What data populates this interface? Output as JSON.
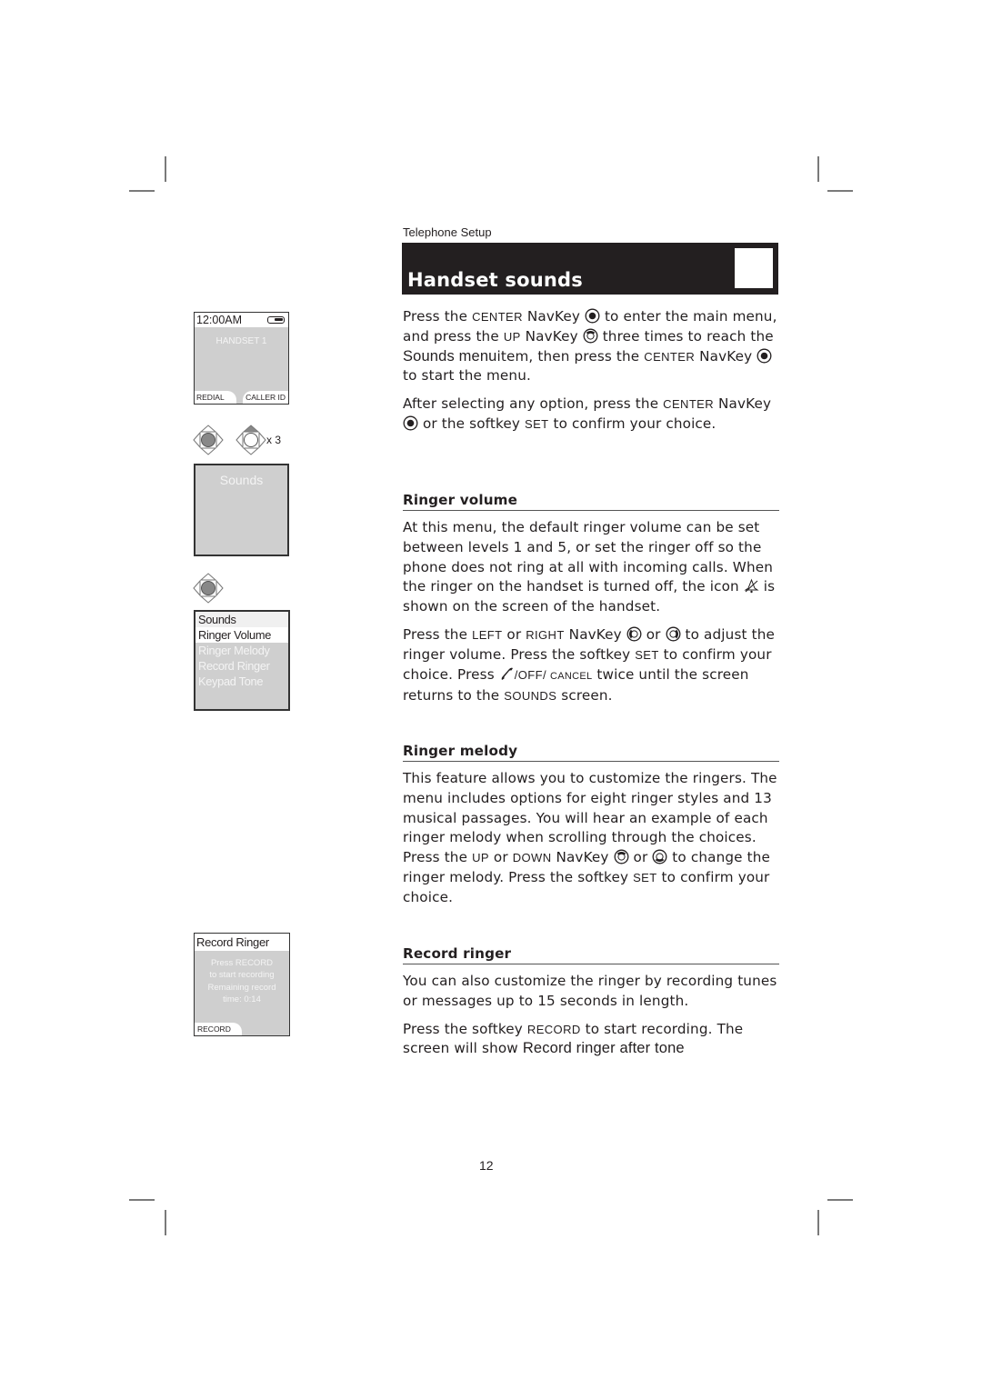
{
  "running_head": "Telephone Setup",
  "title": "Handset sounds",
  "page_number": "12",
  "screens": {
    "idle": {
      "time": "12:00AM",
      "battery_icon": "battery-icon",
      "handset_label": "HANDSET 1",
      "softkey_left": "REDIAL",
      "softkey_right": "CALLER ID"
    },
    "nav_step_1": {
      "icon": "navkey-center-icon"
    },
    "nav_step_2": {
      "icon": "navkey-up-icon",
      "repeat": "x 3"
    },
    "sounds_menu_title": "Sounds",
    "nav_step_3": {
      "icon": "navkey-center-icon"
    },
    "sounds_list": {
      "header": "Sounds",
      "items": [
        "Ringer Volume",
        "Ringer Melody",
        "Record Ringer",
        "Keypad Tone"
      ],
      "selected_index": 0
    },
    "record_ringer": {
      "header": "Record Ringer",
      "lines": [
        "Press RECORD",
        "to start recording",
        "Remaining record",
        "time:   0:14"
      ],
      "softkey": "RECORD"
    }
  },
  "intro": {
    "p1": {
      "t1": "Press the ",
      "k1": "CENTER",
      "t2": " NavKey ",
      "t3": " to enter the main menu, and press the ",
      "k2": "UP",
      "t4": " NavKey ",
      "t5": " three times to reach the ",
      "menu": "Sounds menu",
      "t6": "item, then press the ",
      "k3": "CENTER",
      "t7": " NavKey ",
      "t8": " to start the menu."
    },
    "p2": {
      "t1": "After selecting any option, press the ",
      "k1": "CENTER",
      "t2": " NavKey ",
      "t3": " or the softkey ",
      "k2": "SET",
      "t4": " to confirm your choice."
    }
  },
  "sections": {
    "ringer_volume": {
      "heading": "Ringer volume",
      "p1": {
        "t1": "At this menu, the default ringer volume can be set between levels 1 and 5, or set the ringer off so the phone does not ring at all with incoming calls. When the ringer on the handset is turned off, the icon ",
        "t2": " is shown on the screen of the handset."
      },
      "p2": {
        "t1": "Press the ",
        "k1": "LEFT",
        "t2": " or ",
        "k2": "RIGHT",
        "t3": " NavKey ",
        "t4": " or ",
        "t5": " to adjust the ringer volume. Press the softkey ",
        "k3": "SET",
        "t6": " to confirm your choice. Press ",
        "k4": "/OFF/ ",
        "k5": "CANCEL",
        "t7": " twice until the screen returns to the ",
        "k6": "SOUNDS",
        "t8": " screen."
      }
    },
    "ringer_melody": {
      "heading": "Ringer melody",
      "p1": {
        "t1": "This feature allows you to customize the ringers. The menu includes options for eight ringer styles and 13 musical passages. You will hear an example of each ringer melody when scrolling through the choices. Press the ",
        "k1": "UP",
        "t2": " or ",
        "k2": "DOWN",
        "t3": " NavKey ",
        "t4": " or ",
        "t5": " to change the ringer melody. Press the softkey ",
        "k3": "SET",
        "t6": " to confirm your choice."
      }
    },
    "record_ringer": {
      "heading": "Record ringer",
      "p1": "You can also customize the ringer by recording tunes or messages up to 15 seconds in length.",
      "p2": {
        "t1": "Press the softkey ",
        "k1": "RECORD",
        "t2": " to start recording. The screen will show ",
        "screen_text": "Record ringer after tone"
      }
    }
  }
}
